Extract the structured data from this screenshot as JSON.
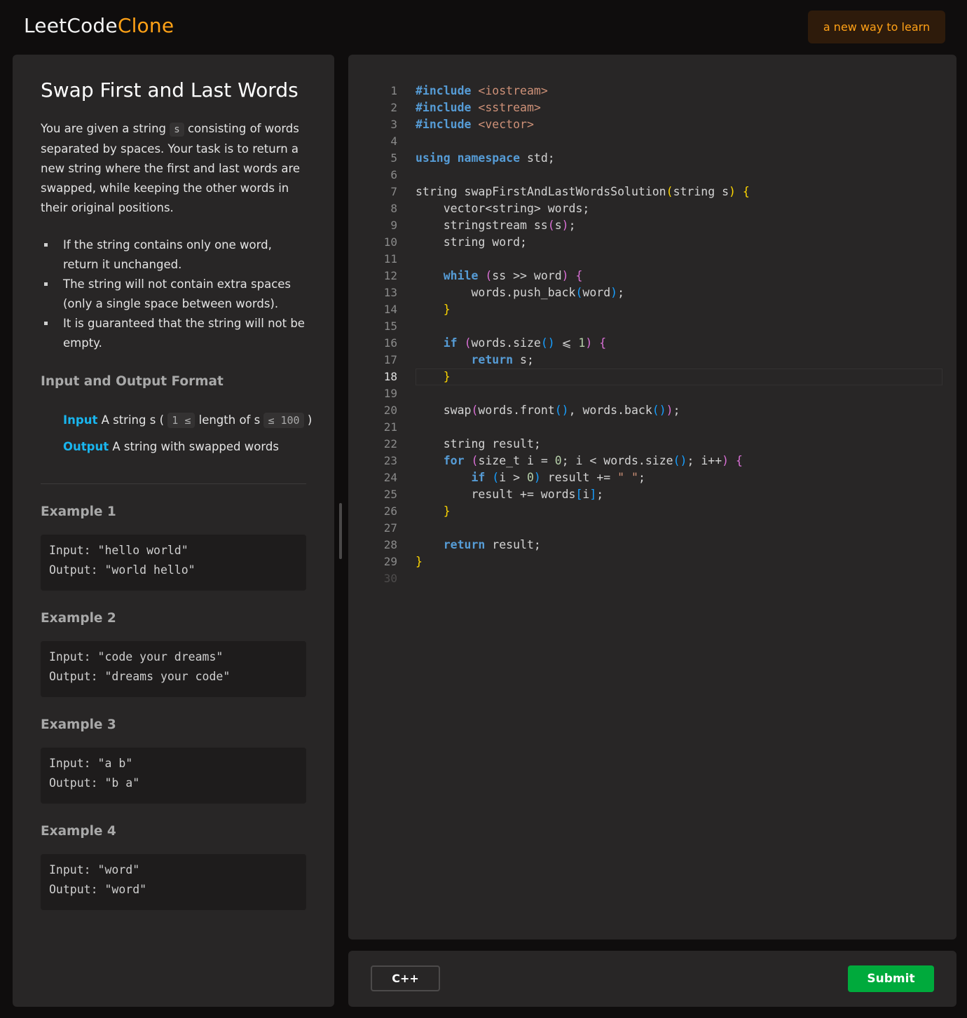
{
  "header": {
    "logo_main": "LeetCode",
    "logo_accent": "Clone",
    "tagline": "a new way to learn"
  },
  "problem": {
    "title": "Swap First and Last Words",
    "description_before": "You are given a string ",
    "description_code": "s",
    "description_after": " consisting of words separated by spaces. Your task is to return a new string where the first and last words are swapped, while keeping the other words in their original positions.",
    "constraints": [
      "If the string contains only one word, return it unchanged.",
      "The string will not contain extra spaces (only a single space between words).",
      "It is guaranteed that the string will not be empty."
    ],
    "io_heading": "Input and Output Format",
    "input_label": "Input",
    "input_text_1": " A string s (",
    "input_code_1": "1 ≤",
    "input_text_2": " length of s ",
    "input_code_2": "≤ 100",
    "input_text_3": ")",
    "output_label": "Output",
    "output_text": " A string with swapped words",
    "examples": [
      {
        "title": "Example 1",
        "input": "Input: \"hello world\"",
        "output": "Output: \"world hello\""
      },
      {
        "title": "Example 2",
        "input": "Input: \"code your dreams\"",
        "output": "Output: \"dreams your code\""
      },
      {
        "title": "Example 3",
        "input": "Input: \"a b\"",
        "output": "Output: \"b a\""
      },
      {
        "title": "Example 4",
        "input": "Input: \"word\"",
        "output": "Output: \"word\""
      }
    ]
  },
  "editor": {
    "active_line": 18,
    "line_numbers": [
      "1",
      "2",
      "3",
      "4",
      "5",
      "6",
      "7",
      "8",
      "9",
      "10",
      "11",
      "12",
      "13",
      "14",
      "15",
      "16",
      "17",
      "18",
      "19",
      "20",
      "21",
      "22",
      "23",
      "24",
      "25",
      "26",
      "27",
      "28",
      "29",
      "30"
    ],
    "lines": [
      "#include <iostream>",
      "#include <sstream>",
      "#include <vector>",
      "",
      "using namespace std;",
      "",
      "string swapFirstAndLastWordsSolution(string s) {",
      "    vector<string> words;",
      "    stringstream ss(s);",
      "    string word;",
      "",
      "    while (ss >> word) {",
      "        words.push_back(word);",
      "    }",
      "",
      "    if (words.size() ⩽ 1) {",
      "        return s;",
      "    }",
      "",
      "    swap(words.front(), words.back());",
      "",
      "    string result;",
      "    for (size_t i = 0; i < words.size(); i++) {",
      "        if (i > 0) result += \" \";",
      "        result += words[i];",
      "    }",
      "",
      "    return result;",
      "}",
      ""
    ]
  },
  "footer": {
    "language": "C++",
    "submit": "Submit"
  },
  "colors": {
    "accent": "#ffa116",
    "link_blue": "#19b5ee",
    "submit_green": "#00aa3c",
    "panel_bg": "#282626",
    "page_bg": "#0f0d0d"
  }
}
